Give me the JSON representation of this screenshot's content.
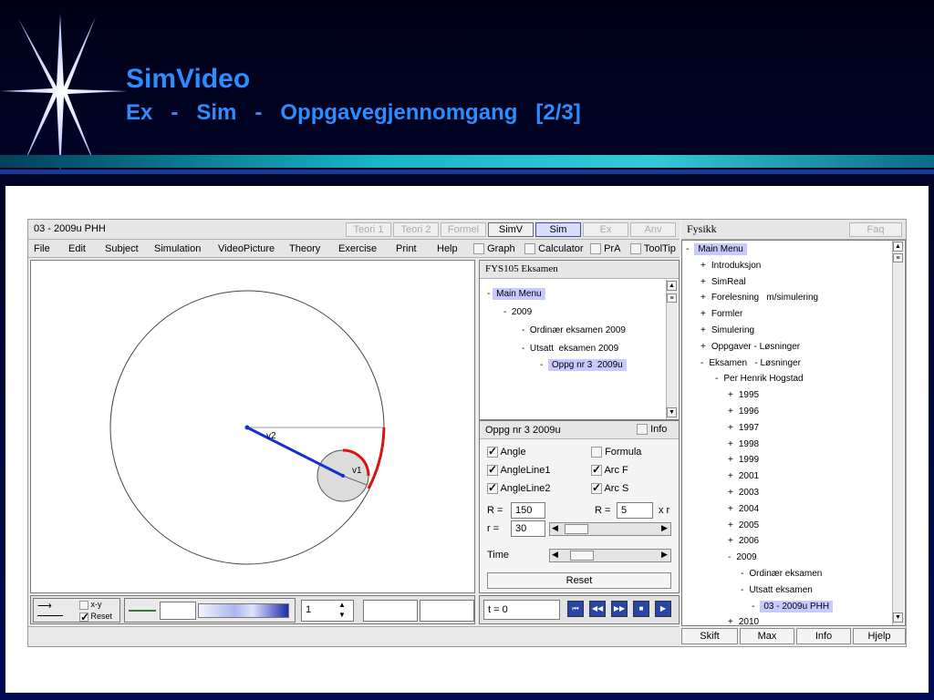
{
  "slide": {
    "title": "SimVideo",
    "subtitle": "Ex   -   Sim   -   Oppgavegjennomgang   [2/3]"
  },
  "window": {
    "title": "03 - 2009u PHH",
    "tabs": [
      "Teori 1",
      "Teori 2",
      "Formel",
      "SimV",
      "Sim",
      "Ex",
      "Anv"
    ],
    "right_title": "Fysikk",
    "right_tab": "Faq"
  },
  "menubar": {
    "items": [
      "File",
      "Edit",
      "Subject",
      "Simulation",
      "VideoPicture",
      "Theory",
      "Exercise",
      "Print",
      "Help"
    ],
    "toggles": [
      "Graph",
      "Calculator",
      "PrA",
      "ToolTip"
    ]
  },
  "canvas": {
    "v2_label": "v2",
    "v1_label": "v1"
  },
  "exam_panel": {
    "title": "FYS105 Eksamen",
    "tree": [
      {
        "prefix": "-",
        "label": "Main Menu"
      },
      {
        "prefix": "-",
        "label": "2009"
      },
      {
        "prefix": "-",
        "label": "Ordinær eksamen 2009"
      },
      {
        "prefix": "-",
        "label": "Utsatt  eksamen 2009"
      },
      {
        "prefix": "-",
        "label": "Oppg nr 3  2009u"
      }
    ]
  },
  "options": {
    "header": "Oppg nr 3   2009u",
    "info_label": "Info",
    "checks": [
      {
        "label": "Angle",
        "checked": true
      },
      {
        "label": "Formula",
        "checked": false
      },
      {
        "label": "AngleLine1",
        "checked": true
      },
      {
        "label": "Arc F",
        "checked": true
      },
      {
        "label": "AngleLine2",
        "checked": true
      },
      {
        "label": "Arc S",
        "checked": true
      }
    ],
    "R_label": "R =",
    "R_value": "150",
    "R2_label": "R =",
    "R2_value": "5",
    "R2_unit": "x r",
    "r_label": "r  =",
    "r_value": "30",
    "time_label": "Time",
    "reset_label": "Reset"
  },
  "bottom": {
    "xy_label": "x-y",
    "reset_label": "Reset",
    "reset_checked": true,
    "spinner_value": "1",
    "time_readout": "t = 0"
  },
  "right_tree": [
    {
      "prefix": "-",
      "label": "Main Menu",
      "depth": 0
    },
    {
      "prefix": "+",
      "label": "Introduksjon",
      "depth": 1
    },
    {
      "prefix": "+",
      "label": "SimReal",
      "depth": 1
    },
    {
      "prefix": "+",
      "label": "Forelesning   m/simulering",
      "depth": 1
    },
    {
      "prefix": "+",
      "label": "Formler",
      "depth": 1
    },
    {
      "prefix": "+",
      "label": "Simulering",
      "depth": 1
    },
    {
      "prefix": "+",
      "label": "Oppgaver - Løsninger",
      "depth": 1
    },
    {
      "prefix": "-",
      "label": "Eksamen   - Løsninger",
      "depth": 1
    },
    {
      "prefix": "-",
      "label": "Per Henrik Hogstad",
      "depth": 2
    },
    {
      "prefix": "+",
      "label": "1995",
      "depth": 3
    },
    {
      "prefix": "+",
      "label": "1996",
      "depth": 3
    },
    {
      "prefix": "+",
      "label": "1997",
      "depth": 3
    },
    {
      "prefix": "+",
      "label": "1998",
      "depth": 3
    },
    {
      "prefix": "+",
      "label": "1999",
      "depth": 3
    },
    {
      "prefix": "+",
      "label": "2001",
      "depth": 3
    },
    {
      "prefix": "+",
      "label": "2003",
      "depth": 3
    },
    {
      "prefix": "+",
      "label": "2004",
      "depth": 3
    },
    {
      "prefix": "+",
      "label": "2005",
      "depth": 3
    },
    {
      "prefix": "+",
      "label": "2006",
      "depth": 3
    },
    {
      "prefix": "-",
      "label": "2009",
      "depth": 3
    },
    {
      "prefix": "-",
      "label": "Ordinær eksamen",
      "depth": 4
    },
    {
      "prefix": "-",
      "label": "Utsatt eksamen",
      "depth": 4
    },
    {
      "prefix": "-",
      "label": "03 - 2009u PHH",
      "depth": 5
    },
    {
      "prefix": "+",
      "label": "2010",
      "depth": 3
    }
  ],
  "right_buttons": [
    "Skift",
    "Max",
    "Info",
    "Hjelp"
  ]
}
